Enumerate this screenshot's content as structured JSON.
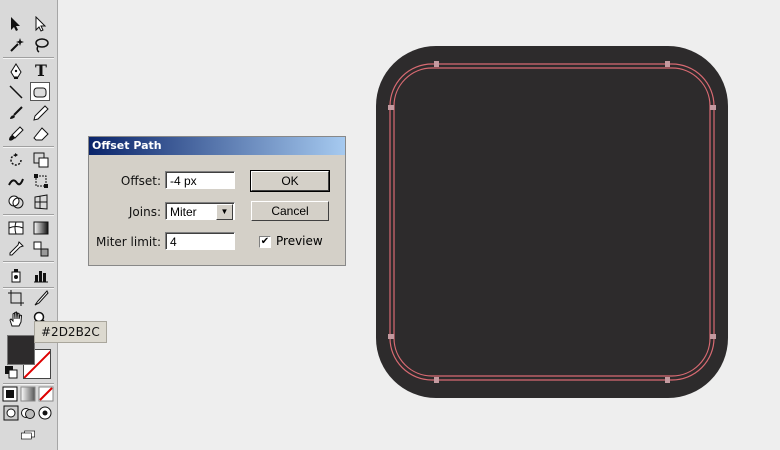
{
  "tooltip": {
    "text": "#2D2B2C"
  },
  "colors": {
    "fill": "#2D2B2C",
    "offset_path_stroke": "#d86a72",
    "dialog_bg": "#d4d0c8",
    "canvas_bg": "#eeeeee"
  },
  "toolbox": {
    "tools": [
      "selection-tool-icon",
      "direct-selection-tool-icon",
      "magic-wand-tool-icon",
      "lasso-tool-icon",
      "pen-tool-icon",
      "type-tool-icon",
      "line-segment-tool-icon",
      "rectangle-tool-icon",
      "paintbrush-tool-icon",
      "pencil-tool-icon",
      "blob-brush-tool-icon",
      "eraser-tool-icon",
      "rotate-tool-icon",
      "scale-tool-icon",
      "warp-tool-icon",
      "free-transform-tool-icon",
      "shape-builder-tool-icon",
      "perspective-grid-tool-icon",
      "mesh-tool-icon",
      "gradient-tool-icon",
      "eyedropper-tool-icon",
      "blend-tool-icon",
      "symbol-sprayer-tool-icon",
      "column-graph-tool-icon",
      "artboard-tool-icon",
      "slice-tool-icon",
      "hand-tool-icon",
      "zoom-tool-icon"
    ],
    "selected_tool": "rectangle-tool-icon"
  },
  "dialog": {
    "title": "Offset Path",
    "offset_label": "Offset:",
    "offset_value": "-4 px",
    "joins_label": "Joins:",
    "joins_value": "Miter",
    "miter_label": "Miter limit:",
    "miter_value": "4",
    "ok_label": "OK",
    "cancel_label": "Cancel",
    "preview_label": "Preview",
    "preview_checked": true
  }
}
